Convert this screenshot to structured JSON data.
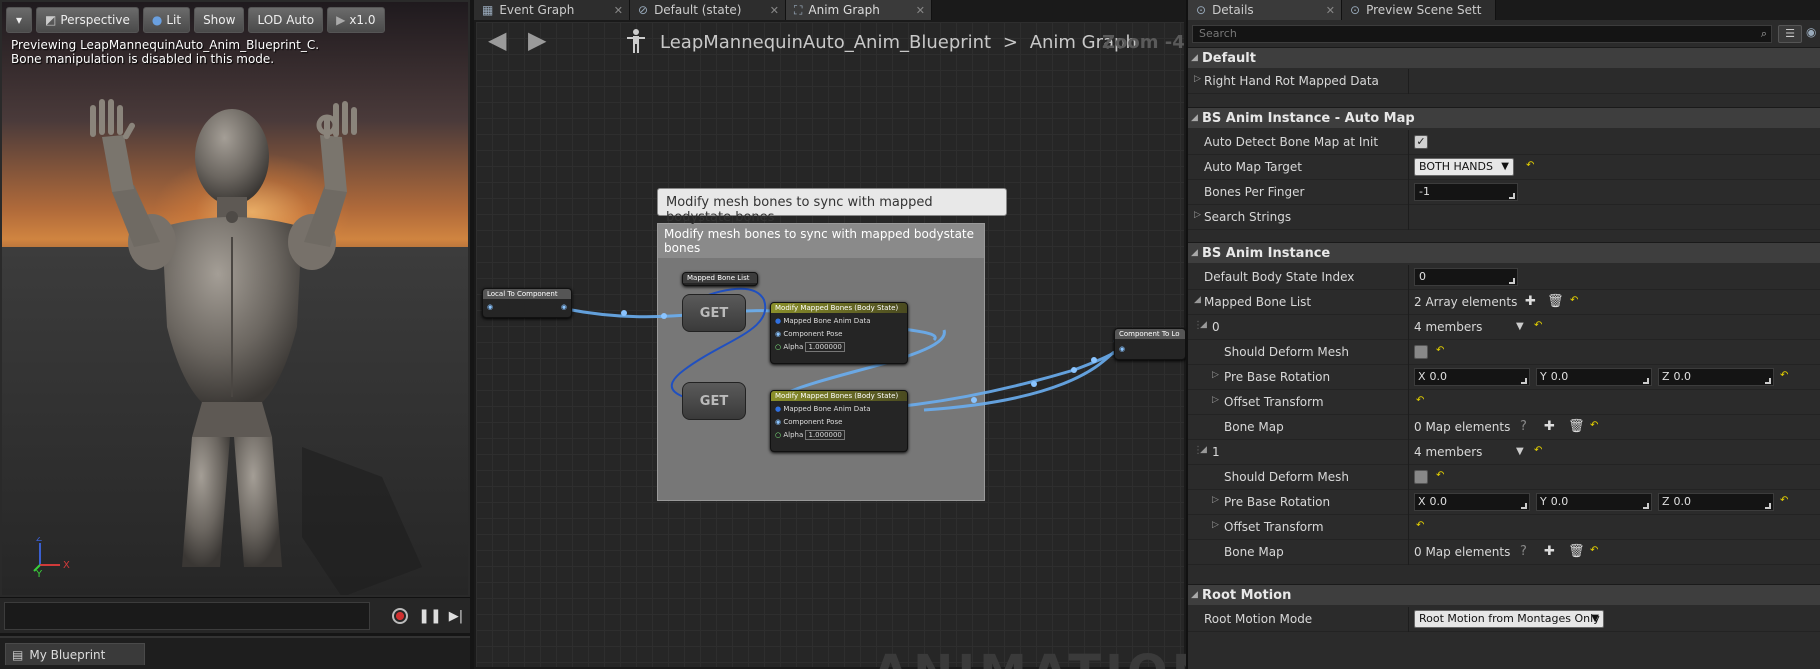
{
  "viewport": {
    "toolbar": {
      "perspective": "Perspective",
      "lit": "Lit",
      "show": "Show",
      "lod": "LOD Auto",
      "speed": "x1.0"
    },
    "status_line1": "Previewing LeapMannequinAuto_Anim_Blueprint_C.",
    "status_line2": "Bone manipulation is disabled in this mode.",
    "axis_y": "Y",
    "axis_x": "X",
    "axis_z": "Z"
  },
  "blueprint_panel": {
    "tab_label": "My Blueprint"
  },
  "graph": {
    "tabs": [
      {
        "label": "Event Graph"
      },
      {
        "label": "Default (state)"
      },
      {
        "label": "Anim Graph"
      }
    ],
    "breadcrumb": {
      "blueprint": "LeapMannequinAuto_Anim_Blueprint",
      "separator": ">",
      "graph": "Anim Graph"
    },
    "zoom": "Zoom -4",
    "watermark": "ANIMATION",
    "tooltip": "Modify mesh bones to sync with mapped bodystate bones",
    "comment_title": "Modify mesh bones to sync with mapped bodystate bones",
    "nodes": {
      "local_to_component": "Local To Component",
      "mapped_bone_list": "Mapped Bone List",
      "get": "GET",
      "modify_title": "Modify Mapped Bones (Body State)",
      "mapped_bone_anim_data": "Mapped Bone Anim Data",
      "component_pose": "Component Pose",
      "alpha": "Alpha",
      "alpha_value": "1.000000",
      "component_to_local": "Component To Lo"
    }
  },
  "details": {
    "tabs": [
      {
        "label": "Details"
      },
      {
        "label": "Preview Scene Sett"
      }
    ],
    "search_placeholder": "Search",
    "categories": {
      "default": "Default",
      "auto_map": "BS Anim Instance - Auto Map",
      "bs_anim": "BS Anim Instance",
      "root_motion": "Root Motion"
    },
    "props": {
      "right_hand_rot": "Right Hand Rot Mapped Data",
      "auto_detect": "Auto Detect Bone Map at Init",
      "auto_map_target": "Auto Map Target",
      "auto_map_target_value": "BOTH HANDS",
      "bones_per_finger": "Bones Per Finger",
      "bones_per_finger_value": "-1",
      "search_strings": "Search Strings",
      "default_body_state_index": "Default Body State Index",
      "default_body_state_index_value": "0",
      "mapped_bone_list": "Mapped Bone List",
      "mapped_bone_list_value": "2 Array elements",
      "elem0": "0",
      "elem1": "1",
      "members": "4 members",
      "should_deform_mesh": "Should Deform Mesh",
      "pre_base_rotation": "Pre Base Rotation",
      "offset_transform": "Offset Transform",
      "bone_map": "Bone Map",
      "bone_map_value": "0 Map elements",
      "vec_x_label": "X",
      "vec_y_label": "Y",
      "vec_z_label": "Z",
      "vec_value": "0.0",
      "root_motion_mode": "Root Motion Mode",
      "root_motion_mode_value": "Root Motion from Montages Only"
    }
  }
}
